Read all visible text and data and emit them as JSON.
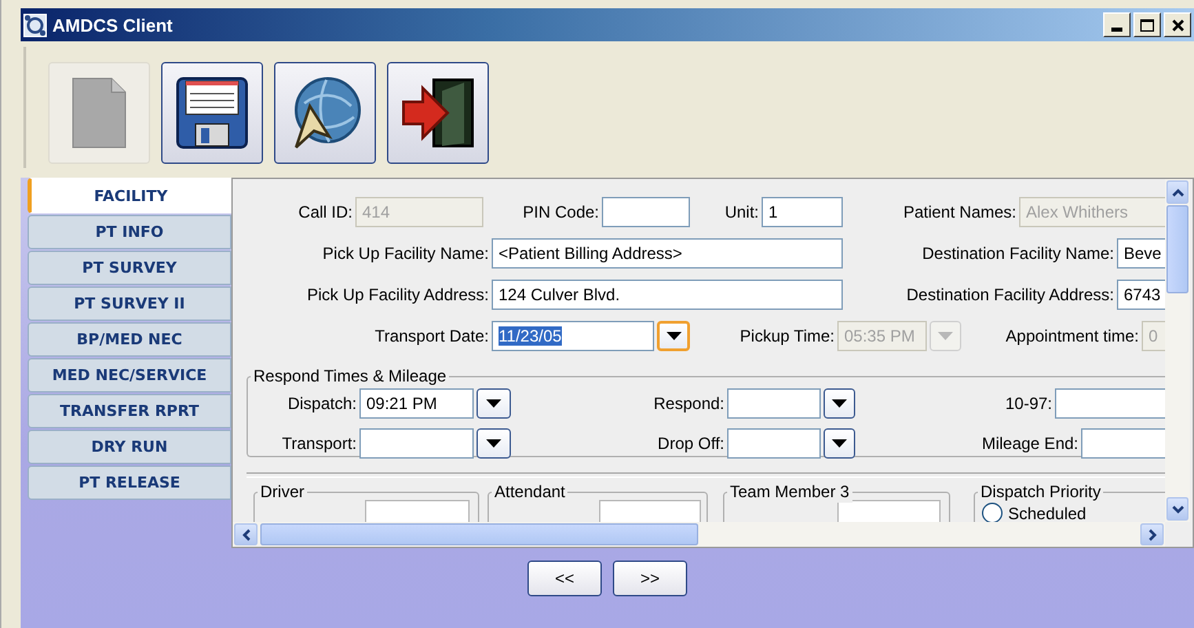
{
  "window": {
    "title": "AMDCS Client"
  },
  "toolbar": [
    {
      "kind": "new",
      "disabled": true
    },
    {
      "kind": "save",
      "disabled": false
    },
    {
      "kind": "navigate",
      "disabled": false
    },
    {
      "kind": "exit",
      "disabled": false
    }
  ],
  "tabs": [
    {
      "label": "FACILITY",
      "selected": true
    },
    {
      "label": "PT INFO",
      "selected": false
    },
    {
      "label": "PT SURVEY",
      "selected": false
    },
    {
      "label": "PT SURVEY II",
      "selected": false
    },
    {
      "label": "BP/MED NEC",
      "selected": false
    },
    {
      "label": "MED NEC/SERVICE",
      "selected": false
    },
    {
      "label": "TRANSFER RPRT",
      "selected": false
    },
    {
      "label": "DRY RUN",
      "selected": false
    },
    {
      "label": "PT RELEASE",
      "selected": false
    }
  ],
  "form_rows": [
    [
      {
        "kind": "text",
        "label": "Call ID:",
        "value": "414",
        "disabled": true
      },
      {
        "kind": "text",
        "label": "PIN Code:",
        "disabled": false
      },
      {
        "kind": "text",
        "label": "Unit:",
        "value": "1",
        "disabled": false
      },
      {
        "kind": "text",
        "label": "Patient Names:",
        "value": "Alex Whithers",
        "disabled": true
      }
    ],
    [
      {
        "kind": "text",
        "label": "Pick Up Facility Name:",
        "value": "<Patient Billing  Address>",
        "disabled": false
      },
      {
        "kind": "text",
        "label": "Destination Facility Name:",
        "value": "Beve",
        "disabled": false
      }
    ],
    [
      {
        "kind": "text",
        "label": "Pick Up Facility Address:",
        "value": "124 Culver Blvd.",
        "disabled": false
      },
      {
        "kind": "text",
        "label": "Destination Facility Address:",
        "value": "6743",
        "disabled": false
      }
    ],
    [
      {
        "kind": "combo",
        "label": "Transport Date:",
        "value": "11/23/05",
        "disabled": false,
        "focused": true,
        "highlighted": true
      },
      {
        "kind": "combo",
        "label": "Pickup Time:",
        "value": "05:35 PM",
        "disabled": true
      },
      {
        "kind": "text",
        "label": "Appointment time:",
        "value": "0",
        "disabled": true
      }
    ]
  ],
  "respond_group": {
    "title": "Respond Times & Mileage",
    "rows": [
      [
        {
          "kind": "combo",
          "label": "Dispatch:",
          "value": "09:21 PM",
          "disabled": false
        },
        {
          "kind": "combo",
          "label": "Respond:",
          "disabled": false
        },
        {
          "kind": "text",
          "label": "10-97:",
          "disabled": false
        }
      ],
      [
        {
          "kind": "combo",
          "label": "Transport:",
          "disabled": false
        },
        {
          "kind": "combo",
          "label": "Drop Off:",
          "disabled": false
        },
        {
          "kind": "text",
          "label": "Mileage End:",
          "disabled": false
        }
      ]
    ]
  },
  "lower_groups": [
    {
      "title": "Driver"
    },
    {
      "title": "Attendant"
    },
    {
      "title": "Team Member 3"
    },
    {
      "title": "Dispatch Priority",
      "options": [
        {
          "label": "Scheduled",
          "selected": false
        }
      ]
    }
  ],
  "nav_buttons": [
    "<<",
    ">>"
  ]
}
